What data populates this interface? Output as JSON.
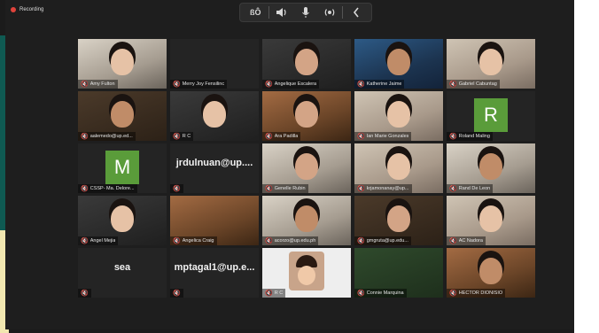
{
  "meeting": {
    "recording_label": "Recording",
    "toolbar": {
      "icons": [
        "captions-icon",
        "speaker-icon",
        "microphone-icon",
        "broadcast-icon",
        "collapse-chevron-icon"
      ],
      "captions_text": "ßÔ"
    }
  },
  "colors": {
    "mute": "#e0433b",
    "avatar_green": "#5a9c3a",
    "tile_bg": "#242424"
  },
  "participants": [
    {
      "name": "Amy Fulton"
    },
    {
      "name": "Merry Joy Fensilinc"
    },
    {
      "name": "Angelique Escalera"
    },
    {
      "name": "Katherine Jaime"
    },
    {
      "name": "Gabriel Cabuntag"
    },
    {
      "name": "aalemedo@up.ed..."
    },
    {
      "name": "R C"
    },
    {
      "name": "Ara Padilla"
    },
    {
      "name": "Ian Marie Gonzales"
    },
    {
      "name": "Roland Maling",
      "avatar": "R"
    },
    {
      "name": "CSSP- Ma. Delore...",
      "avatar": "M"
    },
    {
      "name": "",
      "display_text": "jrdulnuan@up...."
    },
    {
      "name": "Genelle Rubin"
    },
    {
      "name": "krjamonanay@up..."
    },
    {
      "name": "Rand De Leon"
    },
    {
      "name": "Angel Mejia"
    },
    {
      "name": "Angelica Craig"
    },
    {
      "name": "acorzo@up.edu.ph"
    },
    {
      "name": "gmgruta@up.edu..."
    },
    {
      "name": "AC Nadora"
    },
    {
      "name": "",
      "display_text": "sea"
    },
    {
      "name": "",
      "display_text": "mptagal1@up.e..."
    },
    {
      "name": "R C"
    },
    {
      "name": "Connie Marquina"
    },
    {
      "name": "HECTOR DIONISIO"
    }
  ]
}
